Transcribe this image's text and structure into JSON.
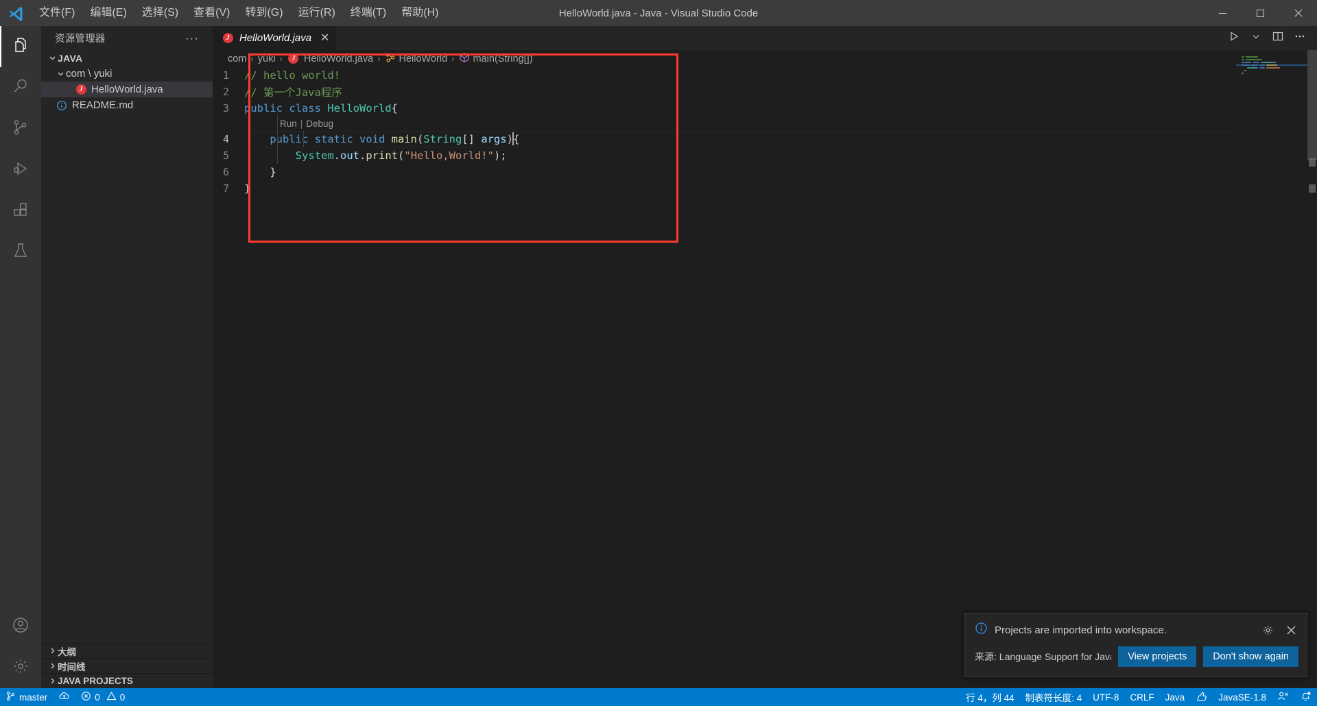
{
  "titlebar": {
    "logo_icon": "vscode-logo-icon",
    "window_title": "HelloWorld.java - Java - Visual Studio Code",
    "menus": [
      {
        "label": "文件(F)",
        "name": "menu-file"
      },
      {
        "label": "编辑(E)",
        "name": "menu-edit"
      },
      {
        "label": "选择(S)",
        "name": "menu-selection"
      },
      {
        "label": "查看(V)",
        "name": "menu-view"
      },
      {
        "label": "转到(G)",
        "name": "menu-goto"
      },
      {
        "label": "运行(R)",
        "name": "menu-run"
      },
      {
        "label": "终端(T)",
        "name": "menu-terminal"
      },
      {
        "label": "帮助(H)",
        "name": "menu-help"
      }
    ],
    "controls": {
      "minimize": "—",
      "maximize": "▢",
      "close": "✕"
    }
  },
  "activitybar": {
    "items": [
      {
        "name": "activity-explorer",
        "icon": "files-icon",
        "active": true
      },
      {
        "name": "activity-search",
        "icon": "search-icon",
        "active": false
      },
      {
        "name": "activity-source-control",
        "icon": "source-control-icon",
        "active": false
      },
      {
        "name": "activity-run-debug",
        "icon": "run-debug-icon",
        "active": false
      },
      {
        "name": "activity-extensions",
        "icon": "extensions-icon",
        "active": false
      },
      {
        "name": "activity-testing",
        "icon": "testing-flask-icon",
        "active": false
      }
    ],
    "bottom": [
      {
        "name": "activity-accounts",
        "icon": "account-icon"
      },
      {
        "name": "activity-settings",
        "icon": "gear-icon"
      }
    ]
  },
  "sidebar": {
    "title": "资源管理器",
    "more_actions": "···",
    "tree": [
      {
        "label": "JAVA",
        "type": "root",
        "expanded": true,
        "chevron": "⌄",
        "indent": 0,
        "bold": true,
        "name": "tree-root-java"
      },
      {
        "label": "com \\ yuki",
        "type": "folder",
        "expanded": true,
        "chevron": "⌄",
        "indent": 1,
        "bold": false,
        "name": "tree-folder-com-yuki"
      },
      {
        "label": "HelloWorld.java",
        "type": "java-file",
        "icon": "java-file-icon",
        "indent": 2,
        "selected": true,
        "name": "tree-file-helloworld-java"
      },
      {
        "label": "README.md",
        "type": "md-file",
        "icon": "markdown-info-icon",
        "indent": 1,
        "selected": false,
        "name": "tree-file-readme-md"
      }
    ],
    "panels": [
      {
        "label": "大纲",
        "chevron": "›",
        "name": "panel-outline",
        "bold": true
      },
      {
        "label": "时间线",
        "chevron": "›",
        "name": "panel-timeline",
        "bold": true
      },
      {
        "label": "JAVA PROJECTS",
        "chevron": "›",
        "name": "panel-java-projects",
        "bold": true
      }
    ]
  },
  "editor": {
    "tab": {
      "label": "HelloWorld.java",
      "icon": "java-file-icon",
      "close": "✕",
      "preview_italic": true
    },
    "actions": [
      {
        "name": "run-code-button",
        "icon": "play-icon"
      },
      {
        "name": "run-options-chevron",
        "icon": "chevron-down-icon"
      },
      {
        "name": "split-editor-button",
        "icon": "split-editor-icon"
      },
      {
        "name": "more-editor-actions-button",
        "icon": "ellipsis-icon"
      }
    ],
    "breadcrumb": [
      {
        "label": "com",
        "icon": "",
        "name": "breadcrumb-com"
      },
      {
        "label": "yuki",
        "icon": "",
        "name": "breadcrumb-yuki"
      },
      {
        "label": "HelloWorld.java",
        "icon": "java-file-icon",
        "name": "breadcrumb-file"
      },
      {
        "label": "HelloWorld",
        "icon": "class-icon",
        "name": "breadcrumb-class"
      },
      {
        "label": "main(String[])",
        "icon": "method-icon",
        "name": "breadcrumb-method"
      }
    ],
    "breadcrumb_sep": "›",
    "codelens": {
      "run": "Run",
      "separator": "|",
      "debug": "Debug"
    },
    "lines": [
      {
        "num": "1",
        "tokens": [
          {
            "t": "// hello world!",
            "c": "t-cmt"
          }
        ]
      },
      {
        "num": "2",
        "tokens": [
          {
            "t": "// 第一个Java程序",
            "c": "t-cmt"
          }
        ]
      },
      {
        "num": "3",
        "tokens": [
          {
            "t": "public ",
            "c": "t-kw"
          },
          {
            "t": "class ",
            "c": "t-kw"
          },
          {
            "t": "HelloWorld",
            "c": "t-cls"
          },
          {
            "t": "{",
            "c": "t-pl"
          }
        ]
      },
      {
        "num": "4",
        "current": true,
        "tokens": [
          {
            "t": "    ",
            "c": "t-pl"
          },
          {
            "t": "public ",
            "c": "t-kw"
          },
          {
            "t": "static ",
            "c": "t-kw"
          },
          {
            "t": "void ",
            "c": "t-kw"
          },
          {
            "t": "main",
            "c": "t-fn"
          },
          {
            "t": "(",
            "c": "t-pl"
          },
          {
            "t": "String",
            "c": "t-cls"
          },
          {
            "t": "[] ",
            "c": "t-pl"
          },
          {
            "t": "args",
            "c": "t-var"
          },
          {
            "t": ")",
            "c": "t-pl"
          },
          {
            "t": "{",
            "c": "t-pl"
          }
        ]
      },
      {
        "num": "5",
        "tokens": [
          {
            "t": "        ",
            "c": "t-pl"
          },
          {
            "t": "System",
            "c": "t-cls"
          },
          {
            "t": ".",
            "c": "t-pl"
          },
          {
            "t": "out",
            "c": "t-var"
          },
          {
            "t": ".",
            "c": "t-pl"
          },
          {
            "t": "print",
            "c": "t-fn"
          },
          {
            "t": "(",
            "c": "t-pl"
          },
          {
            "t": "\"Hello,World!\"",
            "c": "t-str"
          },
          {
            "t": ")",
            "c": "t-pl"
          },
          {
            "t": ";",
            "c": "t-pl"
          }
        ]
      },
      {
        "num": "6",
        "tokens": [
          {
            "t": "    }",
            "c": "t-pl"
          }
        ]
      },
      {
        "num": "7",
        "tokens": [
          {
            "t": "}",
            "c": "t-pl"
          }
        ]
      }
    ]
  },
  "notification": {
    "icon": "info-icon",
    "message": "Projects are imported into workspace.",
    "gear_icon": "gear-icon",
    "close_icon": "close-icon",
    "source": "来源: Language Support for Java(TM) ...",
    "primary_button": "View projects",
    "secondary_button": "Don't show again"
  },
  "statusbar": {
    "left": [
      {
        "icon": "source-control-icon",
        "label": "master",
        "name": "status-branch"
      },
      {
        "icon": "sync-cloud-icon",
        "label": "",
        "name": "status-sync"
      },
      {
        "icon": "error-icon",
        "label": "0",
        "icon2": "warning-icon",
        "label2": "0",
        "name": "status-problems"
      }
    ],
    "right": [
      {
        "label": "行 4，列 44",
        "name": "status-cursor-position"
      },
      {
        "label": "制表符长度: 4",
        "name": "status-indentation"
      },
      {
        "label": "UTF-8",
        "name": "status-encoding"
      },
      {
        "label": "CRLF",
        "name": "status-eol"
      },
      {
        "label": "Java",
        "name": "status-language-mode"
      },
      {
        "icon": "thumbsup-icon",
        "label": "",
        "name": "status-feedback"
      },
      {
        "label": "JavaSE-1.8",
        "name": "status-java-runtime"
      },
      {
        "icon": "remote-icon",
        "label": "",
        "name": "status-remote"
      },
      {
        "icon": "bell-dot-icon",
        "label": "",
        "name": "status-notifications"
      }
    ]
  },
  "colors": {
    "accent": "#007acc",
    "annotation_box": "#ff3b30",
    "button": "#0e639c",
    "editor_bg": "#1e1e1e",
    "sidebar_bg": "#252526",
    "activitybar_bg": "#333333",
    "titlebar_bg": "#3c3c3c"
  }
}
